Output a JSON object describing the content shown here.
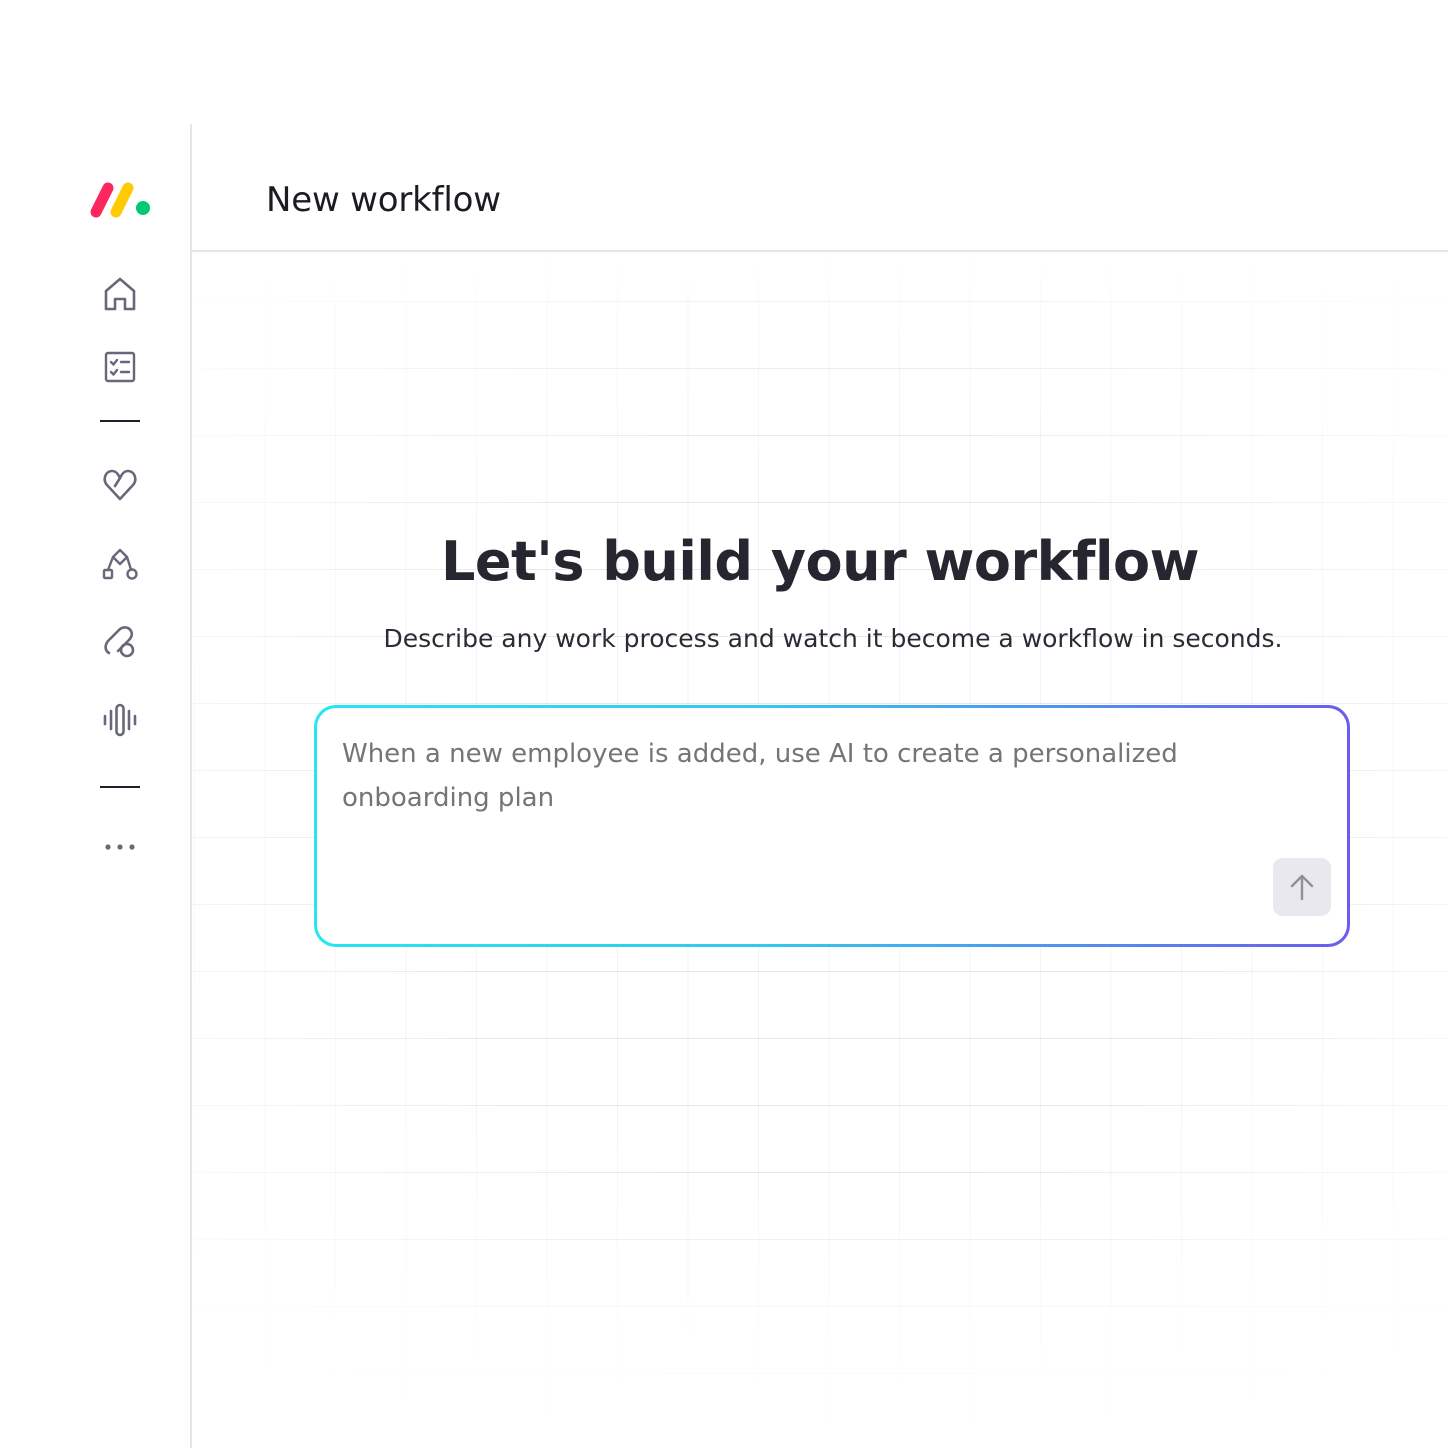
{
  "header": {
    "title": "New workflow"
  },
  "sidebar": {
    "items": [
      {
        "id": "home",
        "icon": "home-icon"
      },
      {
        "id": "tasks",
        "icon": "checklist-icon"
      },
      {
        "id": "favorites",
        "icon": "heart-icon"
      },
      {
        "id": "workflows",
        "icon": "workflow-icon"
      },
      {
        "id": "integrations",
        "icon": "link-icon"
      },
      {
        "id": "voice",
        "icon": "soundwave-icon"
      },
      {
        "id": "more",
        "icon": "more-icon"
      }
    ]
  },
  "main": {
    "title": "Let's build your workflow",
    "subtitle": "Describe any work process and watch it become a workflow in seconds.",
    "prompt": {
      "placeholder": "When a new employee is added, use AI to create a personalized onboarding plan",
      "value": ""
    },
    "send_icon": "arrow-up-icon"
  },
  "colors": {
    "logo_red": "#fb275d",
    "logo_yellow": "#ffcb00",
    "logo_green": "#00ca72",
    "prompt_gradient_start": "#27e6f2",
    "prompt_gradient_end": "#6a5cf0",
    "icon_stroke": "#676879"
  }
}
